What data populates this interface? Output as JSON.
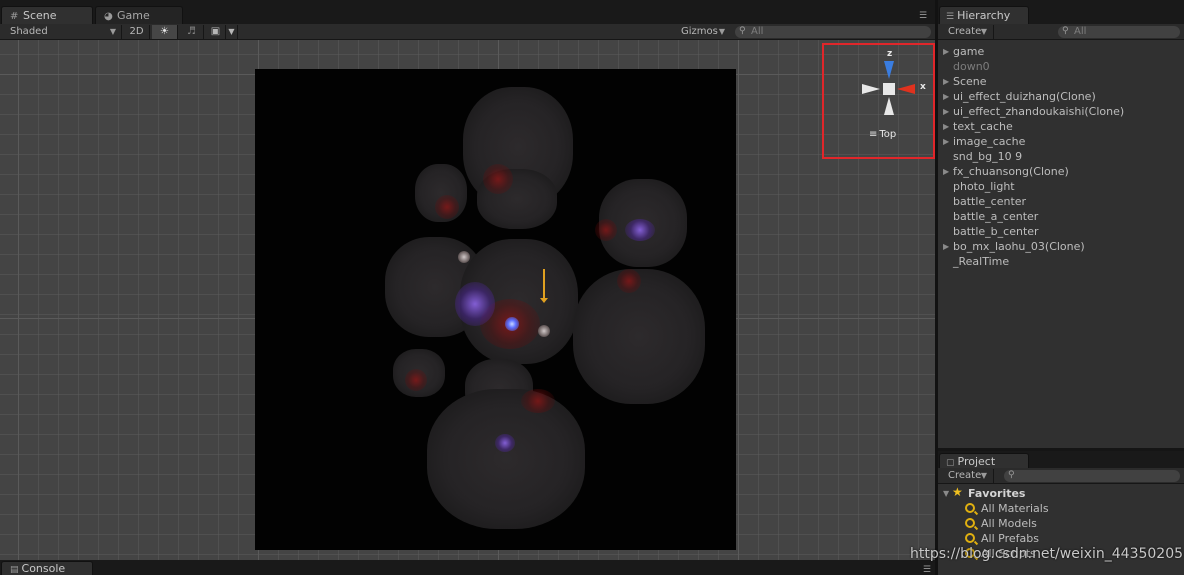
{
  "scene": {
    "tab_label": "Scene",
    "game_tab_label": "Game",
    "shading_mode": "Shaded",
    "mode_2d_label": "2D",
    "gizmos_label": "Gizmos",
    "search_placeholder": "All"
  },
  "gizmo": {
    "z_label": "z",
    "x_label": "x",
    "view_label": "Top"
  },
  "hierarchy": {
    "tab_label": "Hierarchy",
    "create_label": "Create",
    "search_placeholder": "All",
    "items": [
      {
        "label": "game",
        "expandable": true,
        "dim": false
      },
      {
        "label": "down0",
        "expandable": false,
        "dim": true
      },
      {
        "label": "Scene",
        "expandable": true,
        "dim": false
      },
      {
        "label": "ui_effect_duizhang(Clone)",
        "expandable": true,
        "dim": false
      },
      {
        "label": "ui_effect_zhandoukaishi(Clone)",
        "expandable": true,
        "dim": false
      },
      {
        "label": "text_cache",
        "expandable": true,
        "dim": false
      },
      {
        "label": "image_cache",
        "expandable": true,
        "dim": false
      },
      {
        "label": "snd_bg_10 9",
        "expandable": false,
        "dim": false
      },
      {
        "label": "fx_chuansong(Clone)",
        "expandable": true,
        "dim": false
      },
      {
        "label": "photo_light",
        "expandable": false,
        "dim": false
      },
      {
        "label": "battle_center",
        "expandable": false,
        "dim": false
      },
      {
        "label": "battle_a_center",
        "expandable": false,
        "dim": false
      },
      {
        "label": "battle_b_center",
        "expandable": false,
        "dim": false
      },
      {
        "label": "bo_mx_laohu_03(Clone)",
        "expandable": true,
        "dim": false
      },
      {
        "label": "_RealTime",
        "expandable": false,
        "dim": false
      }
    ]
  },
  "project": {
    "tab_label": "Project",
    "create_label": "Create",
    "favorites_label": "Favorites",
    "favorites": [
      "All Materials",
      "All Models",
      "All Prefabs",
      "All Scripts"
    ]
  },
  "console": {
    "tab_label": "Console"
  },
  "watermark": "https://blog.csdn.net/weixin_44350205",
  "colors": {
    "gizmo_highlight": "#e0262a",
    "z_axis": "#3a7de0",
    "x_axis": "#e0321e",
    "favorites_star": "#f0c020"
  }
}
